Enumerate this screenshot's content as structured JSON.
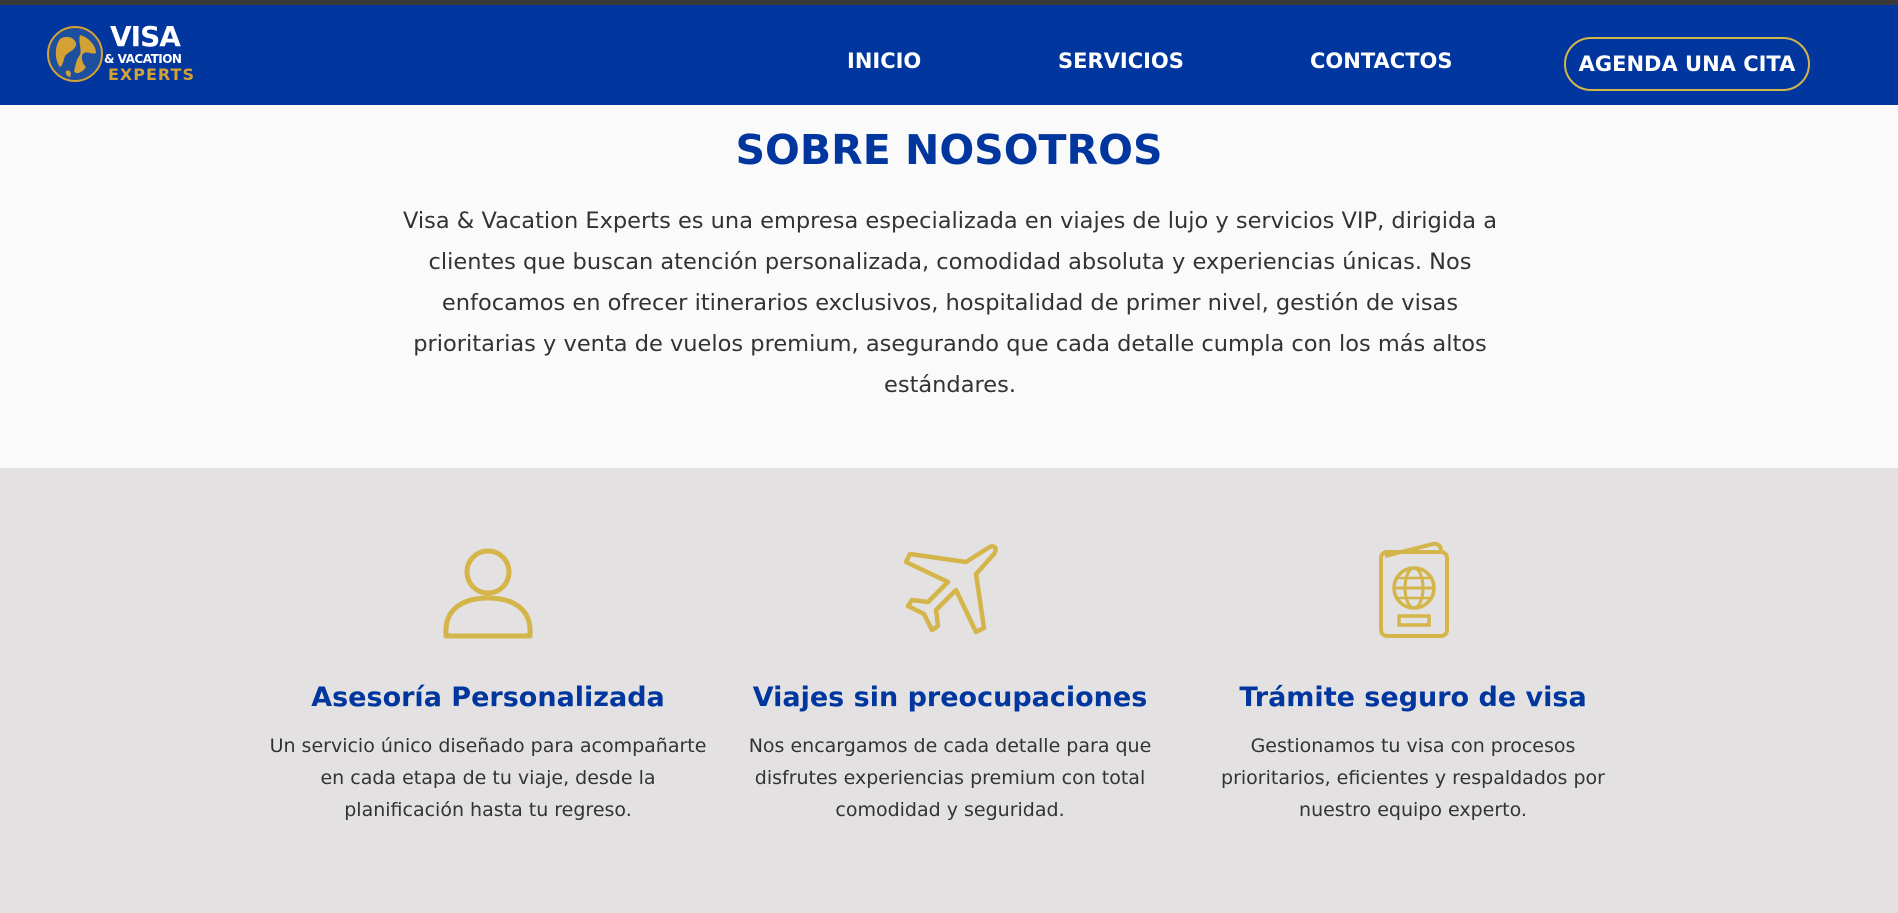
{
  "header": {
    "logo": {
      "line1": "VISA",
      "line2": "& VACATION",
      "line3": "EXPERTS",
      "icon": "globe-icon"
    },
    "nav": {
      "inicio": "INICIO",
      "servicios": "SERVICIOS",
      "contactos": "CONTACTOS"
    },
    "cta_label": "AGENDA UNA CITA"
  },
  "about": {
    "title": "SOBRE NOSOTROS",
    "text": "Visa & Vacation Experts es una empresa especializada en viajes de lujo y servicios VIP, dirigida a clientes que buscan atención personalizada, comodidad absoluta y experiencias únicas. Nos enfocamos en ofrecer itinerarios exclusivos, hospitalidad de primer nivel, gestión de visas prioritarias y venta de vuelos premium, asegurando que cada detalle cumpla con los más altos estándares."
  },
  "features": [
    {
      "icon": "user-icon",
      "title": "Asesoría Personalizada",
      "description": "Un servicio único diseñado para acompañarte en cada etapa de tu viaje, desde la planificación hasta tu regreso."
    },
    {
      "icon": "airplane-icon",
      "title": "Viajes sin preocupaciones",
      "description": "Nos encargamos de cada detalle para que disfrutes experiencias premium con total comodidad y seguridad."
    },
    {
      "icon": "passport-icon",
      "title": "Trámite seguro de visa",
      "description": "Gestionamos tu visa con procesos prioritarios, eficientes y respaldados por nuestro equipo experto."
    }
  ],
  "colors": {
    "brand_blue": "#00369e",
    "gold": "#d4a134",
    "icon_gold": "#d4b54a",
    "features_bg": "#e3e1e2",
    "page_bg": "#fafafa"
  }
}
